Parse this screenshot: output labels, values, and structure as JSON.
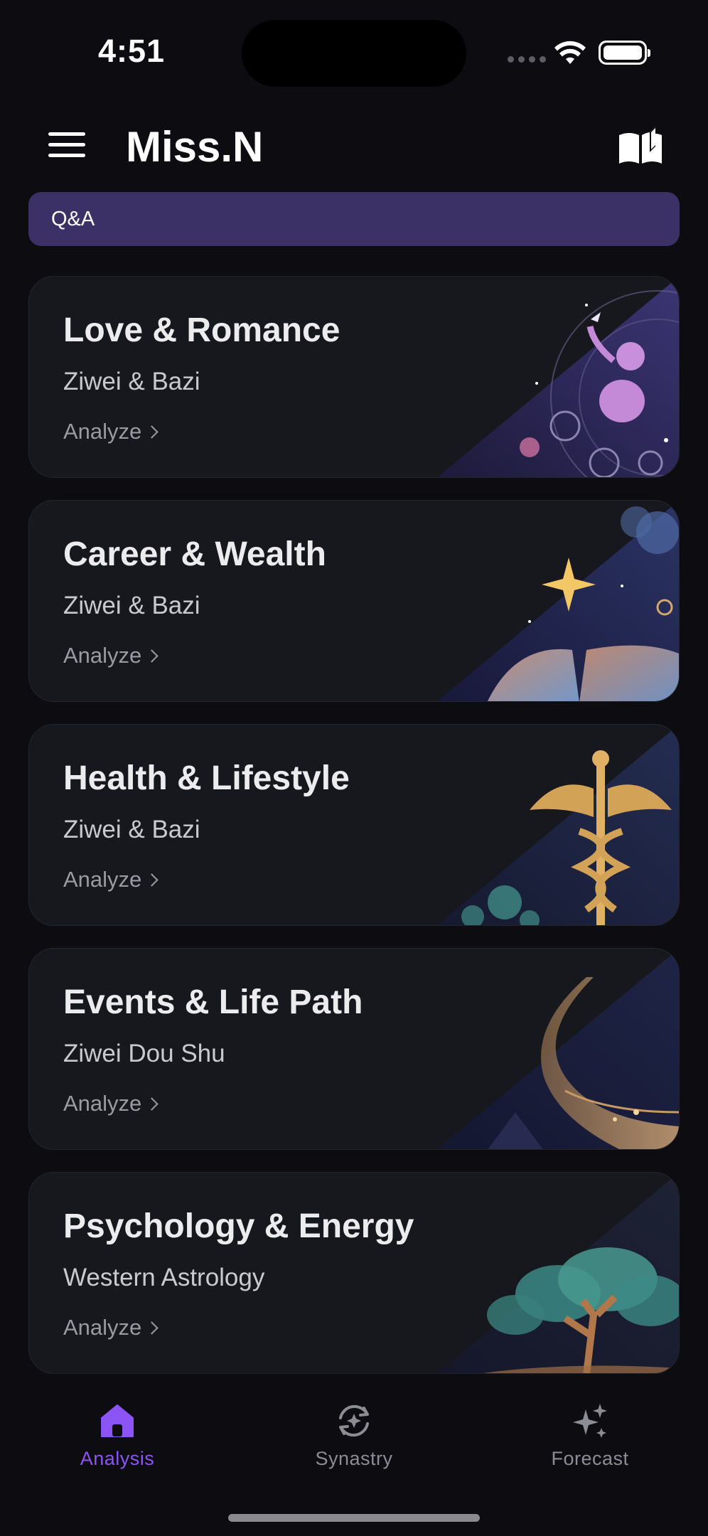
{
  "status_bar": {
    "time": "4:51"
  },
  "header": {
    "title": "Miss.N"
  },
  "qa_bar": {
    "label": "Q&A"
  },
  "cards": [
    {
      "title": "Love & Romance",
      "subtitle": "Ziwei & Bazi",
      "action": "Analyze",
      "art": "zodiac-child-icon"
    },
    {
      "title": "Career & Wealth",
      "subtitle": "Ziwei & Bazi",
      "action": "Analyze",
      "art": "open-book-icon"
    },
    {
      "title": "Health & Lifestyle",
      "subtitle": "Ziwei & Bazi",
      "action": "Analyze",
      "art": "caduceus-icon"
    },
    {
      "title": "Events & Life Path",
      "subtitle": "Ziwei Dou Shu",
      "action": "Analyze",
      "art": "river-path-icon"
    },
    {
      "title": "Psychology & Energy",
      "subtitle": "Western Astrology",
      "action": "Analyze",
      "art": "tree-icon"
    }
  ],
  "tab_bar": {
    "tabs": [
      {
        "label": "Analysis",
        "active": true
      },
      {
        "label": "Synastry",
        "active": false
      },
      {
        "label": "Forecast",
        "active": false
      }
    ]
  },
  "colors": {
    "background": "#0d0d11",
    "card": "#17181d",
    "qa_bar": "#3c3166",
    "accent": "#8c54f4"
  }
}
